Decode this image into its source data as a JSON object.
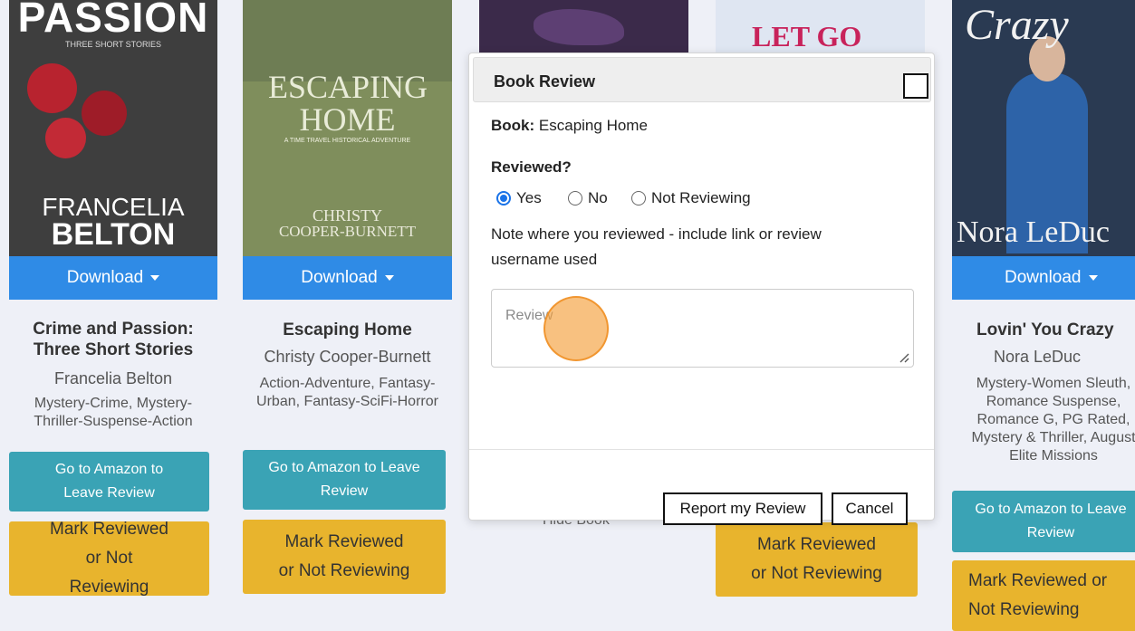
{
  "books": [
    {
      "cover": {
        "title": "PASSION",
        "subtitle": "THREE SHORT STORIES",
        "author_line1": "FRANCELIA",
        "author_line2": "BELTON",
        "bg": "#3e3e3e"
      },
      "download_label": "Download",
      "title": "Crime and Passion: Three Short Stories",
      "author": "Francelia Belton",
      "genres": "Mystery-Crime, Mystery-Thriller-Suspense-Action",
      "amazon_label": "Go to Amazon to Leave Review",
      "mark_label": "Mark Reviewed or Not Reviewing"
    },
    {
      "cover": {
        "title": "ESCAPING HOME",
        "subtitle": "A TIME TRAVEL HISTORICAL ADVENTURE",
        "author_line1": "CHRISTY",
        "author_line2": "COOPER-BURNETT",
        "bg": "#7f8e5c"
      },
      "download_label": "Download",
      "title": "Escaping Home",
      "author": "Christy Cooper-Burnett",
      "genres": "Action-Adventure, Fantasy-Urban, Fantasy-SciFi-Horror",
      "amazon_label": "Go to Amazon to Leave Review",
      "mark_label": "Mark Reviewed or Not Reviewing"
    },
    {
      "cover": {
        "bg": "#3b2a4a"
      },
      "hidden_label": "Hide Book"
    },
    {
      "cover": {
        "title": "LET GO HEAL",
        "bg": "#dfe6f2"
      },
      "mark_label": "Mark Reviewed or Not Reviewing"
    },
    {
      "cover": {
        "title": "Crazy",
        "author_line1": "Nora LeDuc",
        "bg": "#2a3a52"
      },
      "download_label": "Download",
      "title": "Lovin' You Crazy",
      "author": "Nora LeDuc",
      "genres": "Mystery-Women Sleuth, Romance Suspense, Romance G, PG Rated, Mystery & Thriller, August Elite Missions",
      "amazon_label": "Go to Amazon to Leave Review",
      "mark_label": "Mark Reviewed or Not Reviewing"
    }
  ],
  "modal": {
    "title": "Book Review",
    "book_label": "Book:",
    "book_name": "Escaping Home",
    "reviewed_label": "Reviewed?",
    "options": [
      "Yes",
      "No",
      "Not Reviewing"
    ],
    "selected": "Yes",
    "note": "Note where you reviewed - include link or review username used",
    "review_placeholder": "Review",
    "report_button": "Report my Review",
    "cancel_button": "Cancel"
  }
}
